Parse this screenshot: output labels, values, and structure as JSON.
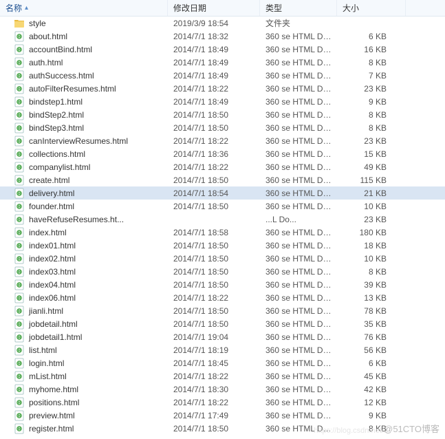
{
  "header": {
    "name": "名称",
    "date": "修改日期",
    "type": "类型",
    "size": "大小"
  },
  "rows": [
    {
      "icon": "folder",
      "name": "style",
      "date": "2019/3/9 18:54",
      "type": "文件夹",
      "size": "",
      "selected": false
    },
    {
      "icon": "html",
      "name": "about.html",
      "date": "2014/7/1 18:32",
      "type": "360 se HTML Do...",
      "size": "6 KB",
      "selected": false
    },
    {
      "icon": "html",
      "name": "accountBind.html",
      "date": "2014/7/1 18:49",
      "type": "360 se HTML Do...",
      "size": "16 KB",
      "selected": false
    },
    {
      "icon": "html",
      "name": "auth.html",
      "date": "2014/7/1 18:49",
      "type": "360 se HTML Do...",
      "size": "8 KB",
      "selected": false
    },
    {
      "icon": "html",
      "name": "authSuccess.html",
      "date": "2014/7/1 18:49",
      "type": "360 se HTML Do...",
      "size": "7 KB",
      "selected": false
    },
    {
      "icon": "html",
      "name": "autoFilterResumes.html",
      "date": "2014/7/1 18:22",
      "type": "360 se HTML Do...",
      "size": "23 KB",
      "selected": false
    },
    {
      "icon": "html",
      "name": "bindstep1.html",
      "date": "2014/7/1 18:49",
      "type": "360 se HTML Do...",
      "size": "9 KB",
      "selected": false
    },
    {
      "icon": "html",
      "name": "bindStep2.html",
      "date": "2014/7/1 18:50",
      "type": "360 se HTML Do...",
      "size": "8 KB",
      "selected": false
    },
    {
      "icon": "html",
      "name": "bindStep3.html",
      "date": "2014/7/1 18:50",
      "type": "360 se HTML Do...",
      "size": "8 KB",
      "selected": false
    },
    {
      "icon": "html",
      "name": "canInterviewResumes.html",
      "date": "2014/7/1 18:22",
      "type": "360 se HTML Do...",
      "size": "23 KB",
      "selected": false
    },
    {
      "icon": "html",
      "name": "collections.html",
      "date": "2014/7/1 18:36",
      "type": "360 se HTML Do...",
      "size": "15 KB",
      "selected": false
    },
    {
      "icon": "html",
      "name": "companylist.html",
      "date": "2014/7/1 18:22",
      "type": "360 se HTML Do...",
      "size": "49 KB",
      "selected": false
    },
    {
      "icon": "html",
      "name": "create.html",
      "date": "2014/7/1 18:50",
      "type": "360 se HTML Do...",
      "size": "115 KB",
      "selected": false
    },
    {
      "icon": "html",
      "name": "delivery.html",
      "date": "2014/7/1 18:54",
      "type": "360 se HTML Do...",
      "size": "21 KB",
      "selected": true
    },
    {
      "icon": "html",
      "name": "founder.html",
      "date": "2014/7/1 18:50",
      "type": "360 se HTML Do...",
      "size": "10 KB",
      "selected": false
    },
    {
      "icon": "html",
      "name": "haveRefuseResumes.ht...",
      "date": "",
      "type": "...L Do...",
      "size": "23 KB",
      "selected": false
    },
    {
      "icon": "html",
      "name": "index.html",
      "date": "2014/7/1 18:58",
      "type": "360 se HTML Do...",
      "size": "180 KB",
      "selected": false
    },
    {
      "icon": "html",
      "name": "index01.html",
      "date": "2014/7/1 18:50",
      "type": "360 se HTML Do...",
      "size": "18 KB",
      "selected": false
    },
    {
      "icon": "html",
      "name": "index02.html",
      "date": "2014/7/1 18:50",
      "type": "360 se HTML Do...",
      "size": "10 KB",
      "selected": false
    },
    {
      "icon": "html",
      "name": "index03.html",
      "date": "2014/7/1 18:50",
      "type": "360 se HTML Do...",
      "size": "8 KB",
      "selected": false
    },
    {
      "icon": "html",
      "name": "index04.html",
      "date": "2014/7/1 18:50",
      "type": "360 se HTML Do...",
      "size": "39 KB",
      "selected": false
    },
    {
      "icon": "html",
      "name": "index06.html",
      "date": "2014/7/1 18:22",
      "type": "360 se HTML Do...",
      "size": "13 KB",
      "selected": false
    },
    {
      "icon": "html",
      "name": "jianli.html",
      "date": "2014/7/1 18:50",
      "type": "360 se HTML Do...",
      "size": "78 KB",
      "selected": false
    },
    {
      "icon": "html",
      "name": "jobdetail.html",
      "date": "2014/7/1 18:50",
      "type": "360 se HTML Do...",
      "size": "35 KB",
      "selected": false
    },
    {
      "icon": "html",
      "name": "jobdetail1.html",
      "date": "2014/7/1 19:04",
      "type": "360 se HTML Do...",
      "size": "76 KB",
      "selected": false
    },
    {
      "icon": "html",
      "name": "list.html",
      "date": "2014/7/1 18:19",
      "type": "360 se HTML Do...",
      "size": "56 KB",
      "selected": false
    },
    {
      "icon": "html",
      "name": "login.html",
      "date": "2014/7/1 18:45",
      "type": "360 se HTML Do...",
      "size": "6 KB",
      "selected": false
    },
    {
      "icon": "html",
      "name": "mList.html",
      "date": "2014/7/1 18:22",
      "type": "360 se HTML Do...",
      "size": "45 KB",
      "selected": false
    },
    {
      "icon": "html",
      "name": "myhome.html",
      "date": "2014/7/1 18:30",
      "type": "360 se HTML Do...",
      "size": "42 KB",
      "selected": false
    },
    {
      "icon": "html",
      "name": "positions.html",
      "date": "2014/7/1 18:22",
      "type": "360 se HTML Do...",
      "size": "12 KB",
      "selected": false
    },
    {
      "icon": "html",
      "name": "preview.html",
      "date": "2014/7/1 17:49",
      "type": "360 se HTML Do...",
      "size": "9 KB",
      "selected": false
    },
    {
      "icon": "html",
      "name": "register.html",
      "date": "2014/7/1 18:50",
      "type": "360 se HTML Do...",
      "size": "8 KB",
      "selected": false
    }
  ],
  "watermark": "@51CTO博客",
  "watermark2": "https://blog.csdn.net/..."
}
